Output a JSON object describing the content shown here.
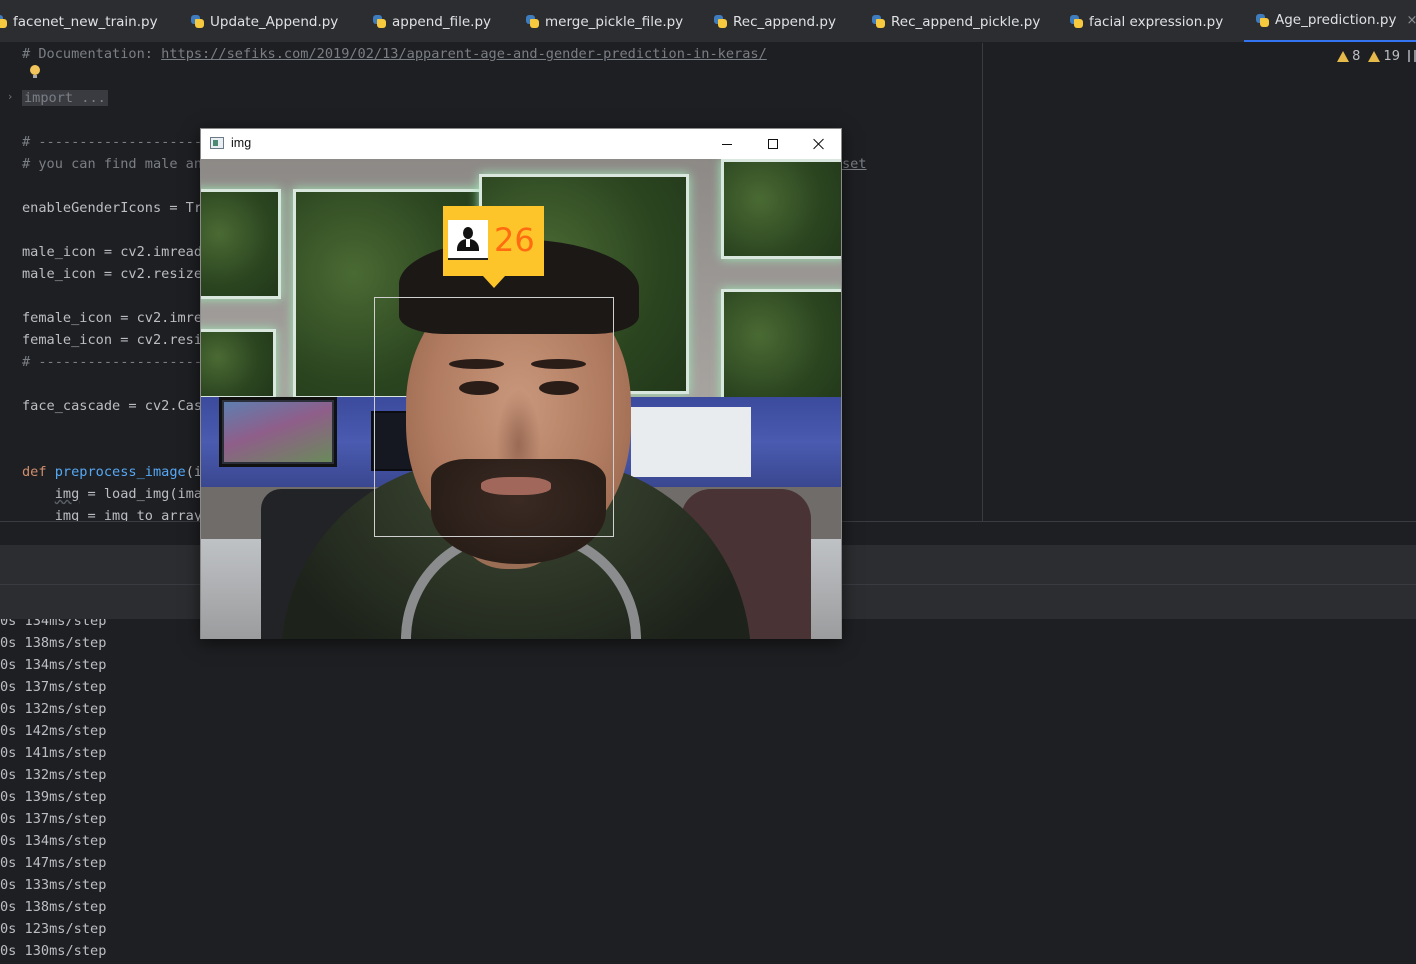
{
  "tabs": [
    {
      "label": "facenet_new_train.py",
      "active": false
    },
    {
      "label": "Update_Append.py",
      "active": false
    },
    {
      "label": "append_file.py",
      "active": false
    },
    {
      "label": "merge_pickle_file.py",
      "active": false
    },
    {
      "label": "Rec_append.py",
      "active": false
    },
    {
      "label": "Rec_append_pickle.py",
      "active": false
    },
    {
      "label": "facial expression.py",
      "active": false
    },
    {
      "label": "Age_prediction.py",
      "active": true,
      "close_label": "×"
    }
  ],
  "inspections": {
    "warnings": "8",
    "weak_warnings": "19"
  },
  "editor": {
    "line_doc_prefix": "# Documentation: ",
    "line_doc_link": "https://sefiks.com/2019/02/13/apparent-age-and-gender-prediction-in-keras/",
    "line_import": "import ...",
    "line_sep1": "# --------------------",
    "line_find_comment": "# you can find male an",
    "line_find_tail": "set",
    "line_enable": "enableGenderIcons = Tr",
    "line_male1": "male_icon = cv2.imread",
    "line_male2": "male_icon = cv2.resize",
    "line_female1": "female_icon = cv2.imre",
    "line_female2": "female_icon = cv2.resi",
    "line_sep2": "# ---------------------",
    "line_cascade": "face_cascade = cv2.Cas",
    "line_def_kw": "def ",
    "line_def_name": "preprocess_image",
    "line_def_rest": "(i",
    "line_img1_var": "img",
    "line_img1_rest": " = load_img(imag",
    "line_img2": "    img = img_to_array"
  },
  "console": {
    "lines": [
      "0s 134ms/step",
      "0s 138ms/step",
      "0s 134ms/step",
      "0s 137ms/step",
      "0s 132ms/step",
      "0s 142ms/step",
      "0s 141ms/step",
      "0s 132ms/step",
      "0s 139ms/step",
      "0s 137ms/step",
      "0s 134ms/step",
      "0s 147ms/step",
      "0s 133ms/step",
      "0s 138ms/step",
      "0s 123ms/step",
      "0s 130ms/step"
    ]
  },
  "image_window": {
    "title": "img",
    "predicted_age": "26",
    "gender_icon": "male-person-icon"
  },
  "colors": {
    "editor_bg": "#1e1f22",
    "tab_bar_bg": "#2b2d30",
    "comment": "#7a7e85",
    "keyword": "#cf8e6d",
    "function": "#56a8f5",
    "age_label_bg": "#fdc52a",
    "age_text": "#ff6b10"
  }
}
